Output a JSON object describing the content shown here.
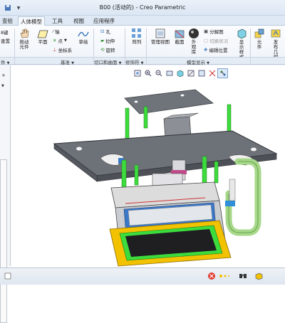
{
  "window": {
    "title": "B00 (活动的) - Creo Parametric"
  },
  "quick_access": {
    "dropdown_glyph": "▼"
  },
  "tabs": [
    "查验",
    "人体模型",
    "工具",
    "视图",
    "应用程序"
  ],
  "ribbon": {
    "partial_left_top": "8键",
    "partial_left_bottom": "查置",
    "tools": {
      "drag": "拖动元件",
      "plane": "平面",
      "axis": "轴",
      "point": "点",
      "csys": "坐标系",
      "sketch": "草绘",
      "hole": "孔",
      "extrude": "拉伸",
      "revolve": "旋转",
      "pattern": "阵列",
      "manage_views": "管理视图",
      "section": "截面",
      "appearance": "外观库",
      "exploded": "分解图",
      "toggle_status": "切换状况",
      "edit_position": "编辑位置",
      "display_style": "显示样式",
      "component": "元件",
      "publish": "发布几何"
    }
  },
  "groups": [
    "件",
    "基准",
    "切口和曲面",
    "修饰符",
    "模型显示"
  ],
  "group_arrow": "▼",
  "left_panel": {
    "row1": "+",
    "row2": "▼"
  },
  "colors": {
    "accent": "#2f6fb5",
    "frame": "#f2c100",
    "pipe": "#3ddc3d",
    "tube": "#a7d88a",
    "plate": "#6d7178"
  }
}
